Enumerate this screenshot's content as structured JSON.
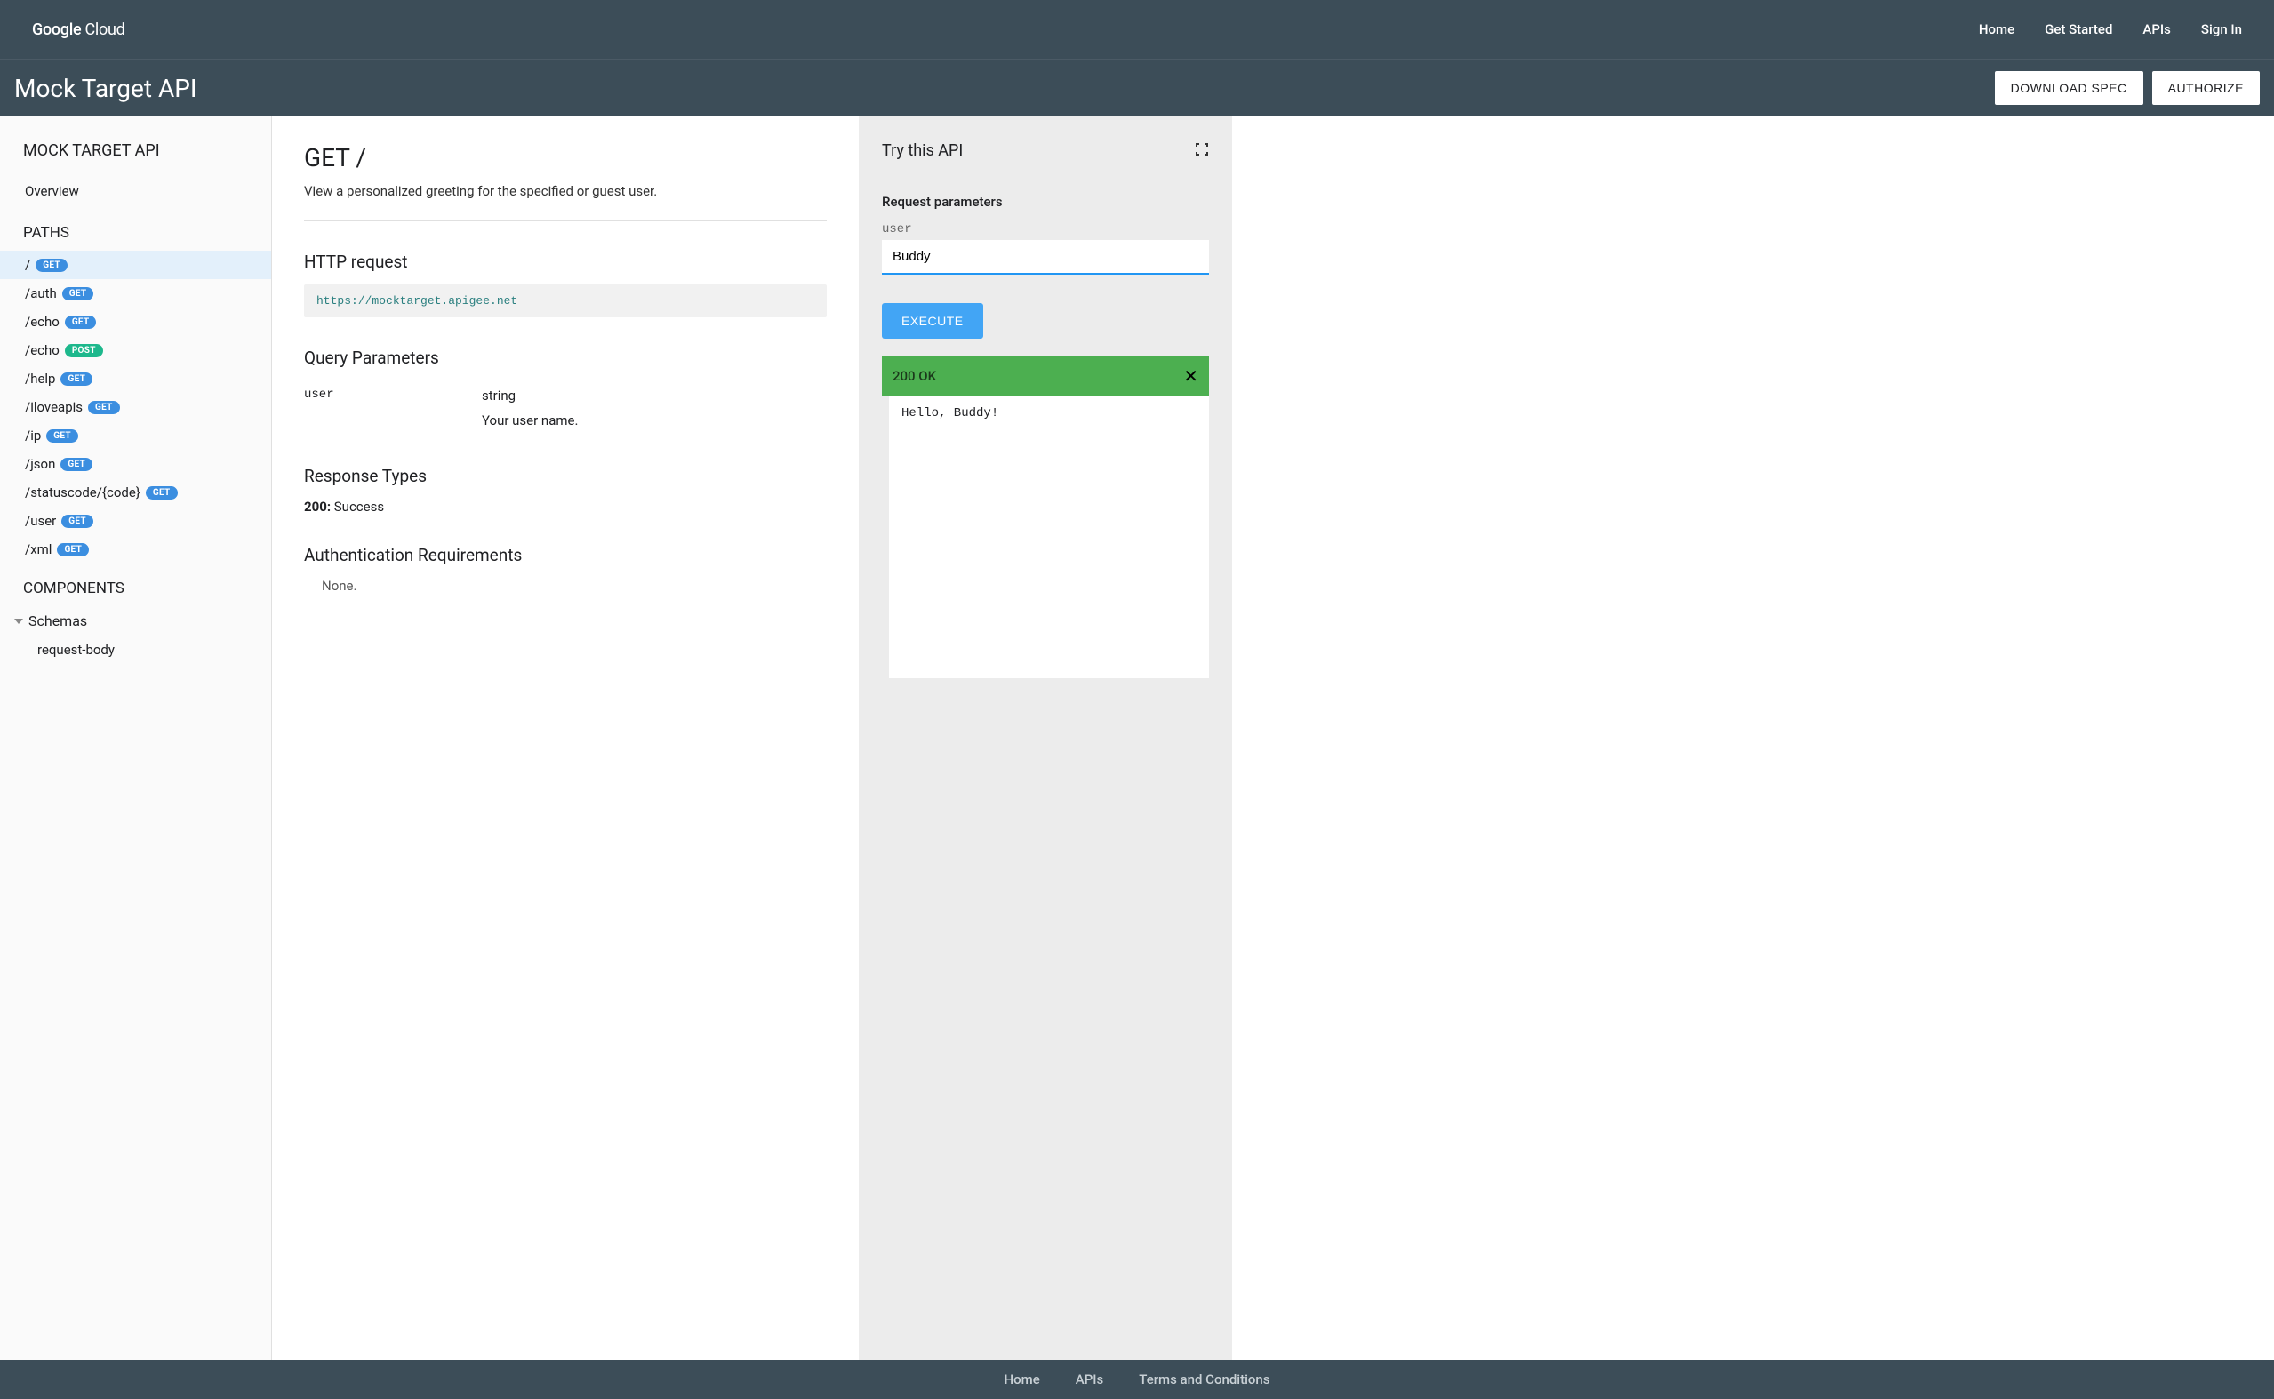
{
  "topnav": {
    "logo_prefix": "Google",
    "logo_suffix": "Cloud",
    "links": [
      "Home",
      "Get Started",
      "APIs",
      "Sign In"
    ]
  },
  "subheader": {
    "title": "Mock Target API",
    "download_spec": "DOWNLOAD SPEC",
    "authorize": "AUTHORIZE"
  },
  "sidebar": {
    "api_name": "MOCK TARGET API",
    "overview": "Overview",
    "paths_heading": "PATHS",
    "paths": [
      {
        "path": "/",
        "method": "GET",
        "active": true
      },
      {
        "path": "/auth",
        "method": "GET",
        "active": false
      },
      {
        "path": "/echo",
        "method": "GET",
        "active": false
      },
      {
        "path": "/echo",
        "method": "POST",
        "active": false
      },
      {
        "path": "/help",
        "method": "GET",
        "active": false
      },
      {
        "path": "/iloveapis",
        "method": "GET",
        "active": false
      },
      {
        "path": "/ip",
        "method": "GET",
        "active": false
      },
      {
        "path": "/json",
        "method": "GET",
        "active": false
      },
      {
        "path": "/statuscode/{code}",
        "method": "GET",
        "active": false
      },
      {
        "path": "/user",
        "method": "GET",
        "active": false
      },
      {
        "path": "/xml",
        "method": "GET",
        "active": false
      }
    ],
    "components_heading": "COMPONENTS",
    "schemas_label": "Schemas",
    "schema_items": [
      "request-body"
    ]
  },
  "doc": {
    "title": "GET /",
    "description": "View a personalized greeting for the specified or guest user.",
    "http_request_heading": "HTTP request",
    "http_request_url": "https://mocktarget.apigee.net",
    "query_params_heading": "Query Parameters",
    "query_params": [
      {
        "name": "user",
        "type": "string",
        "desc": "Your user name."
      }
    ],
    "response_types_heading": "Response Types",
    "responses": [
      {
        "code": "200:",
        "text": " Success"
      }
    ],
    "auth_heading": "Authentication Requirements",
    "auth_none": "None."
  },
  "trypanel": {
    "title": "Try this API",
    "request_params_label": "Request parameters",
    "param_name": "user",
    "param_value": "Buddy",
    "execute_label": "EXECUTE",
    "status_text": "200 OK",
    "response_body": "Hello, Buddy!"
  },
  "footer": {
    "links": [
      "Home",
      "APIs",
      "Terms and Conditions"
    ]
  }
}
